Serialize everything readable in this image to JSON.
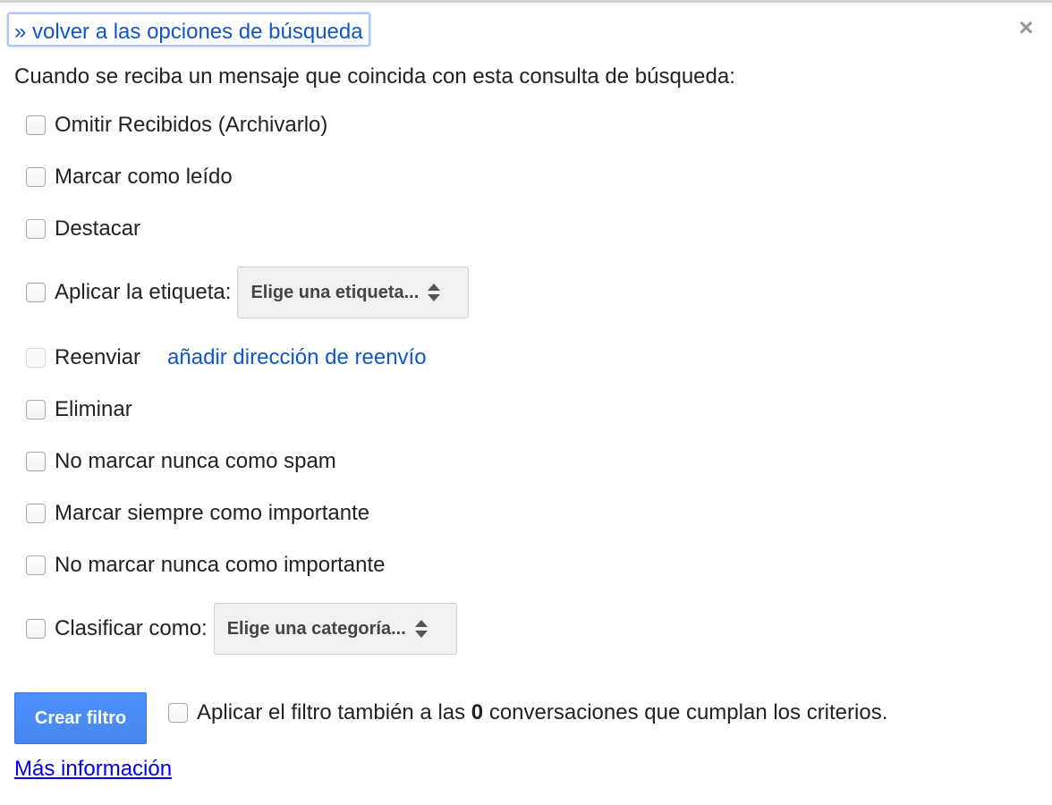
{
  "header": {
    "back_link": "» volver a las opciones de búsqueda",
    "close_icon": "×"
  },
  "intro": "Cuando se reciba un mensaje que coincida con esta consulta de búsqueda:",
  "actions": [
    {
      "label": "Omitir Recibidos (Archivarlo)",
      "checked": false
    },
    {
      "label": "Marcar como leído",
      "checked": false
    },
    {
      "label": "Destacar",
      "checked": false
    },
    {
      "label": "Aplicar la etiqueta:",
      "checked": false,
      "select": "Elige una etiqueta..."
    },
    {
      "label": "Reenviar",
      "checked": false,
      "disabled": true,
      "link": "añadir dirección de reenvío"
    },
    {
      "label": "Eliminar",
      "checked": false
    },
    {
      "label": "No marcar nunca como spam",
      "checked": false
    },
    {
      "label": "Marcar siempre como importante",
      "checked": false
    },
    {
      "label": "No marcar nunca como importante",
      "checked": false
    },
    {
      "label": "Clasificar como:",
      "checked": false,
      "select": "Elige una categoría..."
    }
  ],
  "footer": {
    "create_button": "Crear filtro",
    "apply_prefix": "Aplicar el filtro también a las ",
    "apply_count": "0",
    "apply_suffix": " conversaciones que cumplan los criterios.",
    "more_info": "Más información"
  },
  "colors": {
    "link": "#1155cc",
    "primary_button": "#4d90fe",
    "focus_ring": "#a6c8ff"
  }
}
